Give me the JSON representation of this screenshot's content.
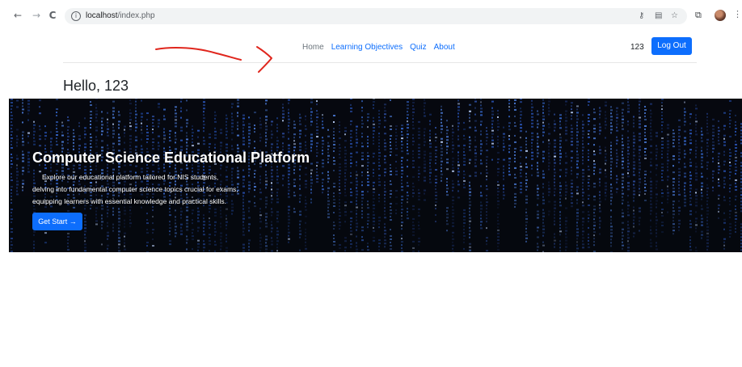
{
  "browser": {
    "back": "←",
    "forward": "→",
    "reload": "C",
    "url_host": "localhost",
    "url_path": "/index.php"
  },
  "nav": {
    "links": [
      "Home",
      "Learning Objectives",
      "Quiz",
      "About"
    ],
    "username": "123",
    "logout_label": "Log Out"
  },
  "greeting": "Hello, 123",
  "hero": {
    "title": "Computer Science Educational Platform",
    "description_lines": [
      "Explore our educational platform tailored for NIS students,",
      "delving into fundamental computer science topics crucial for exams,",
      "equipping learners with essential knowledge and practical skills."
    ],
    "cta_label": "Get Start →"
  },
  "colors": {
    "primary": "#0d6efd",
    "annotation": "#e0261d",
    "hero_background": "#06080f"
  }
}
